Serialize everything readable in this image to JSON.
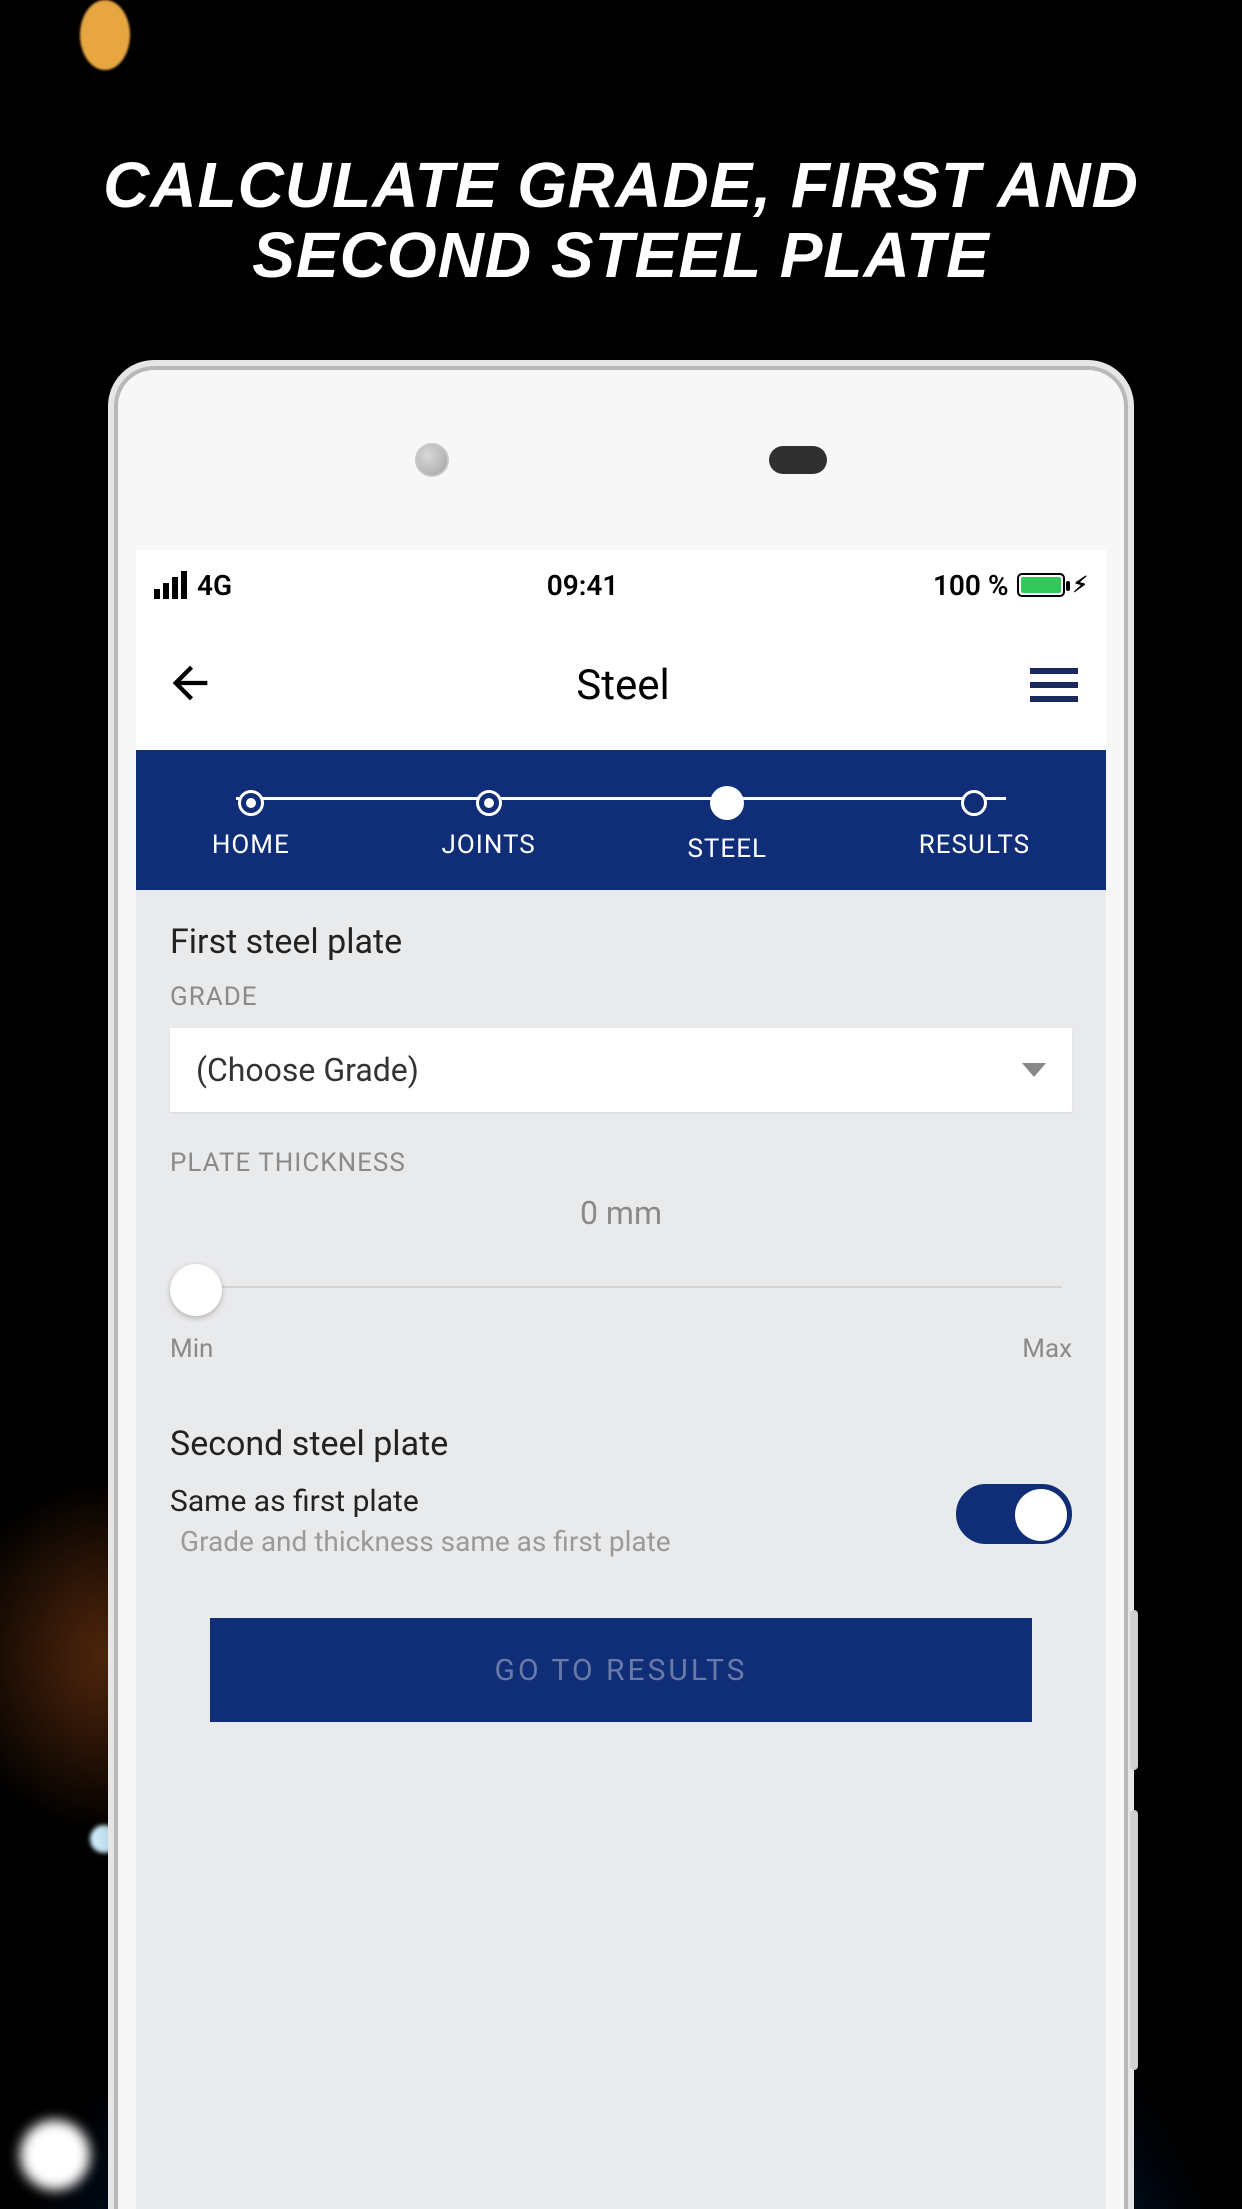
{
  "promo": {
    "headline": "CALCULATE GRADE, FIRST AND SECOND STEEL PLATE"
  },
  "status": {
    "network": "4G",
    "time": "09:41",
    "battery_pct": "100 %"
  },
  "nav": {
    "title": "Steel"
  },
  "stepper": {
    "steps": [
      {
        "label": "HOME"
      },
      {
        "label": "JOINTS"
      },
      {
        "label": "STEEL"
      },
      {
        "label": "RESULTS"
      }
    ]
  },
  "first_plate": {
    "title": "First steel plate",
    "grade_label": "GRADE",
    "grade_value": "(Choose Grade)",
    "thickness_label": "PLATE THICKNESS",
    "thickness_value": "0 mm",
    "slider_min": "Min",
    "slider_max": "Max"
  },
  "second_plate": {
    "title": "Second steel plate",
    "same_label": "Same as first plate",
    "same_desc": "Grade and thickness same as first plate"
  },
  "cta": {
    "label": "GO TO RESULTS"
  }
}
